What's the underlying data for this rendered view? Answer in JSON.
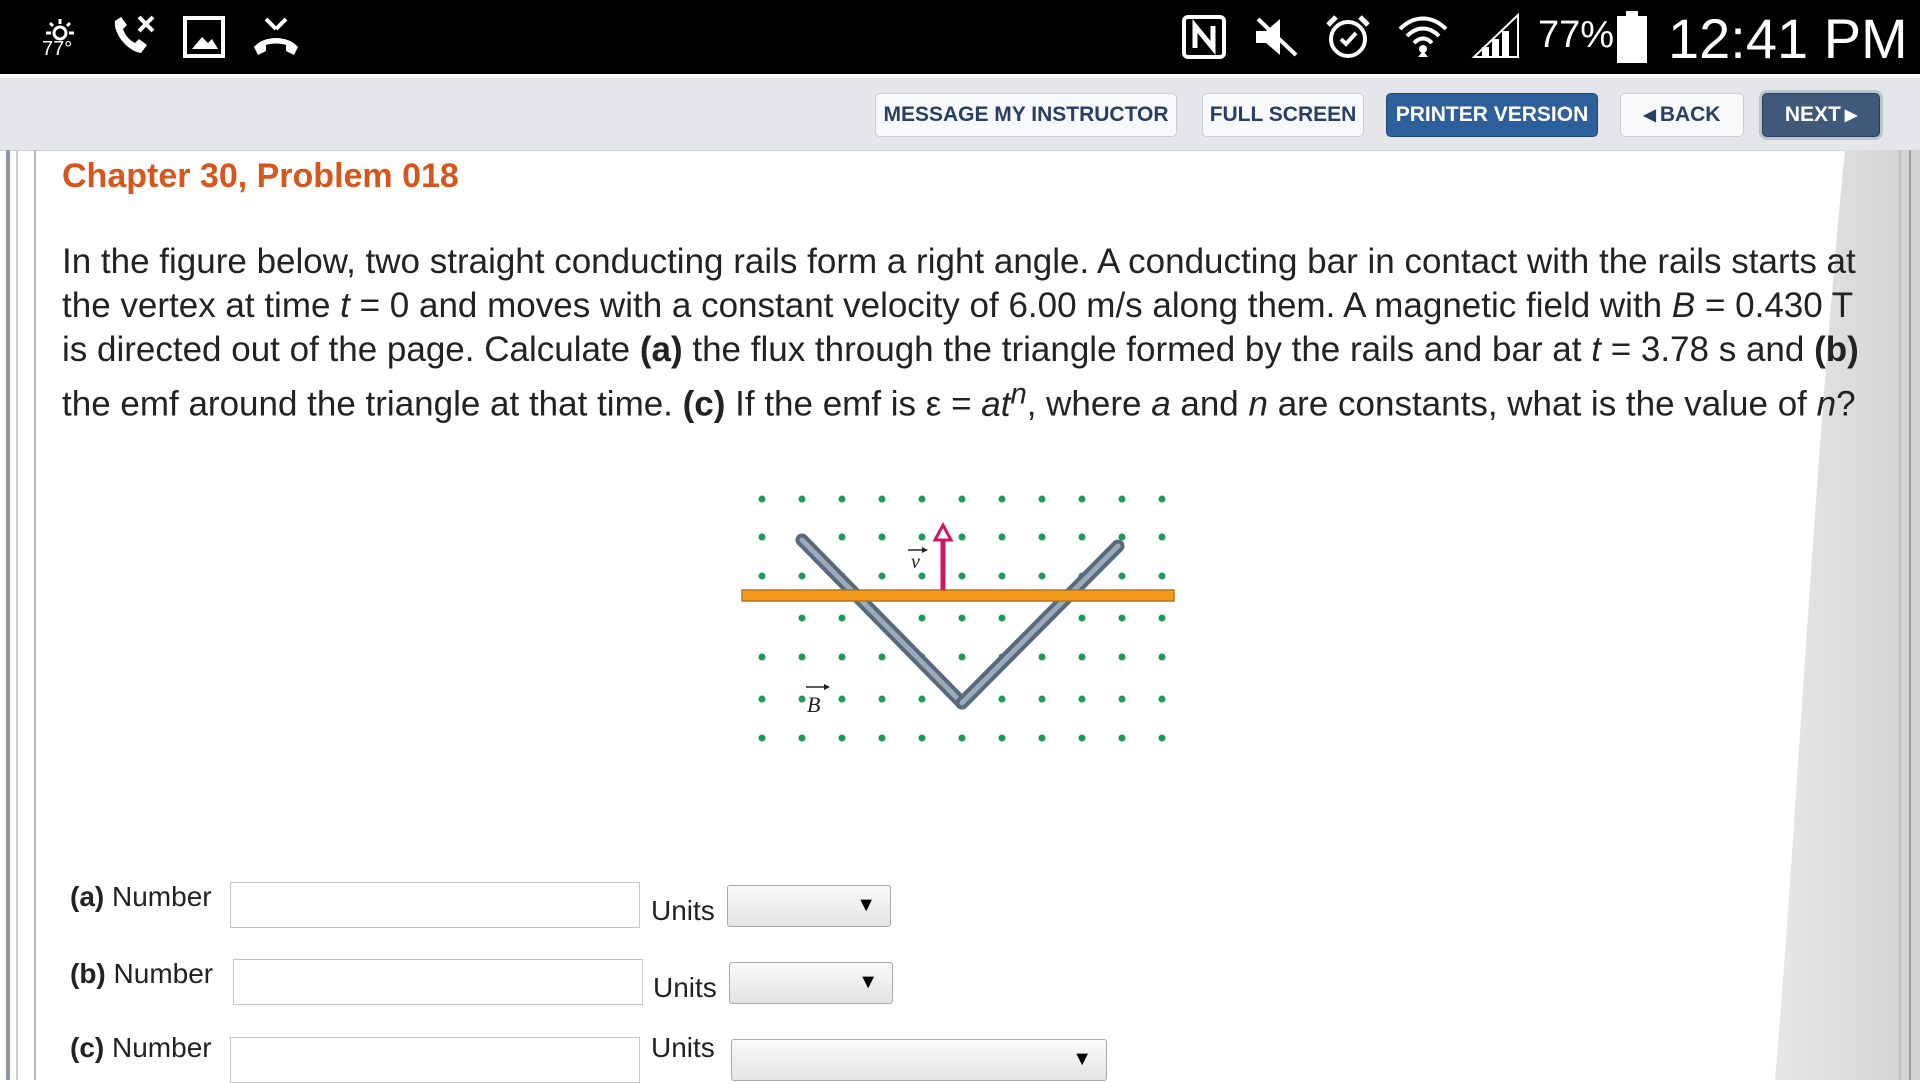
{
  "status_bar": {
    "temperature": "77°",
    "icons_left": [
      "weather-icon",
      "missed-call-icon",
      "gallery-icon",
      "call-end-icon"
    ],
    "icons_right": [
      "nfc-icon",
      "mute-icon",
      "alarm-icon",
      "wifi-icon",
      "signal-icon",
      "battery-icon"
    ],
    "battery": "77%",
    "time": "12:41 PM"
  },
  "toolbar": {
    "message_instructor": "MESSAGE MY INSTRUCTOR",
    "full_screen": "FULL SCREEN",
    "printer_version": "PRINTER VERSION",
    "back": "BACK",
    "next": "NEXT"
  },
  "problem": {
    "title": "Chapter 30, Problem 018",
    "velocity": "6.00 m/s",
    "field": "0.430 T",
    "time": "3.78 s"
  },
  "figure": {
    "v_label": "v",
    "b_label": "B"
  },
  "answers": [
    {
      "part": "(a)",
      "label": "Number",
      "value": "",
      "units_label": "Units",
      "units_value": ""
    },
    {
      "part": "(b)",
      "label": "Number",
      "value": "",
      "units_label": "Units",
      "units_value": ""
    },
    {
      "part": "(c)",
      "label": "Number",
      "value": "",
      "units_label": "Units",
      "units_value": ""
    }
  ],
  "colors": {
    "title": "#d6561c",
    "printer_button": "#2d5f9b",
    "dots": "#1a9b5a",
    "bar": "#f29b1d",
    "velocity_arrow": "#d11566"
  }
}
